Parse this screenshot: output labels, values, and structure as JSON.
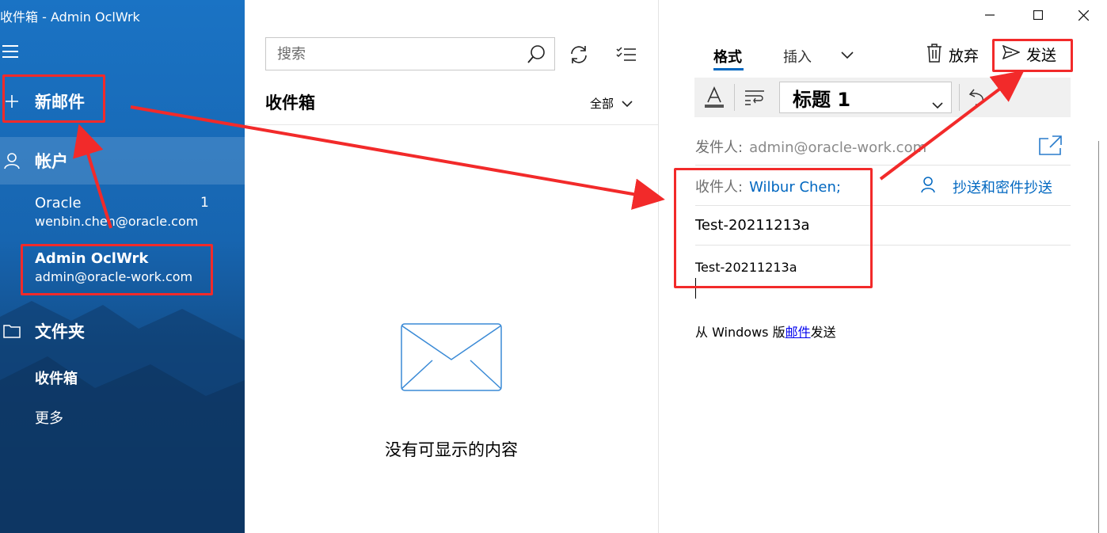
{
  "window": {
    "title": "收件箱 - Admin OclWrk"
  },
  "nav": {
    "new_mail": "新邮件",
    "accounts_label": "帐户",
    "accounts": [
      {
        "name": "Oracle",
        "email": "wenbin.chen@oracle.com",
        "unread": "1"
      },
      {
        "name": "Admin OclWrk",
        "email": "admin@oracle-work.com"
      }
    ],
    "folders_label": "文件夹",
    "folders": [
      {
        "label": "收件箱"
      },
      {
        "label": "更多"
      }
    ]
  },
  "list": {
    "search_placeholder": "搜索",
    "title": "收件箱",
    "filter": "全部",
    "empty_text": "没有可显示的内容"
  },
  "compose": {
    "tabs": {
      "format": "格式",
      "insert": "插入"
    },
    "discard": "放弃",
    "send": "发送",
    "style": "标题 1",
    "from_label": "发件人:",
    "from_value": "admin@oracle-work.com",
    "to_label": "收件人:",
    "to_value": "Wilbur Chen;",
    "cc_bcc": "抄送和密件抄送",
    "subject": "Test-20211213a",
    "body": "Test-20211213a",
    "signature_prefix": "从 Windows 版",
    "signature_link": "邮件",
    "signature_suffix": "发送"
  },
  "colors": {
    "nav_blue": "#1a73c4",
    "accent": "#0067c0",
    "annotation": "#f22a2a"
  },
  "icons": {
    "hamburger": "hamburger-icon",
    "plus": "plus-icon",
    "person": "person-icon",
    "folder": "folder-icon",
    "search": "search-icon",
    "sync": "sync-icon",
    "select": "select-mode-icon",
    "envelope": "envelope-icon",
    "trash": "trash-icon",
    "send": "send-icon",
    "undo": "undo-icon",
    "popout": "popout-icon"
  }
}
